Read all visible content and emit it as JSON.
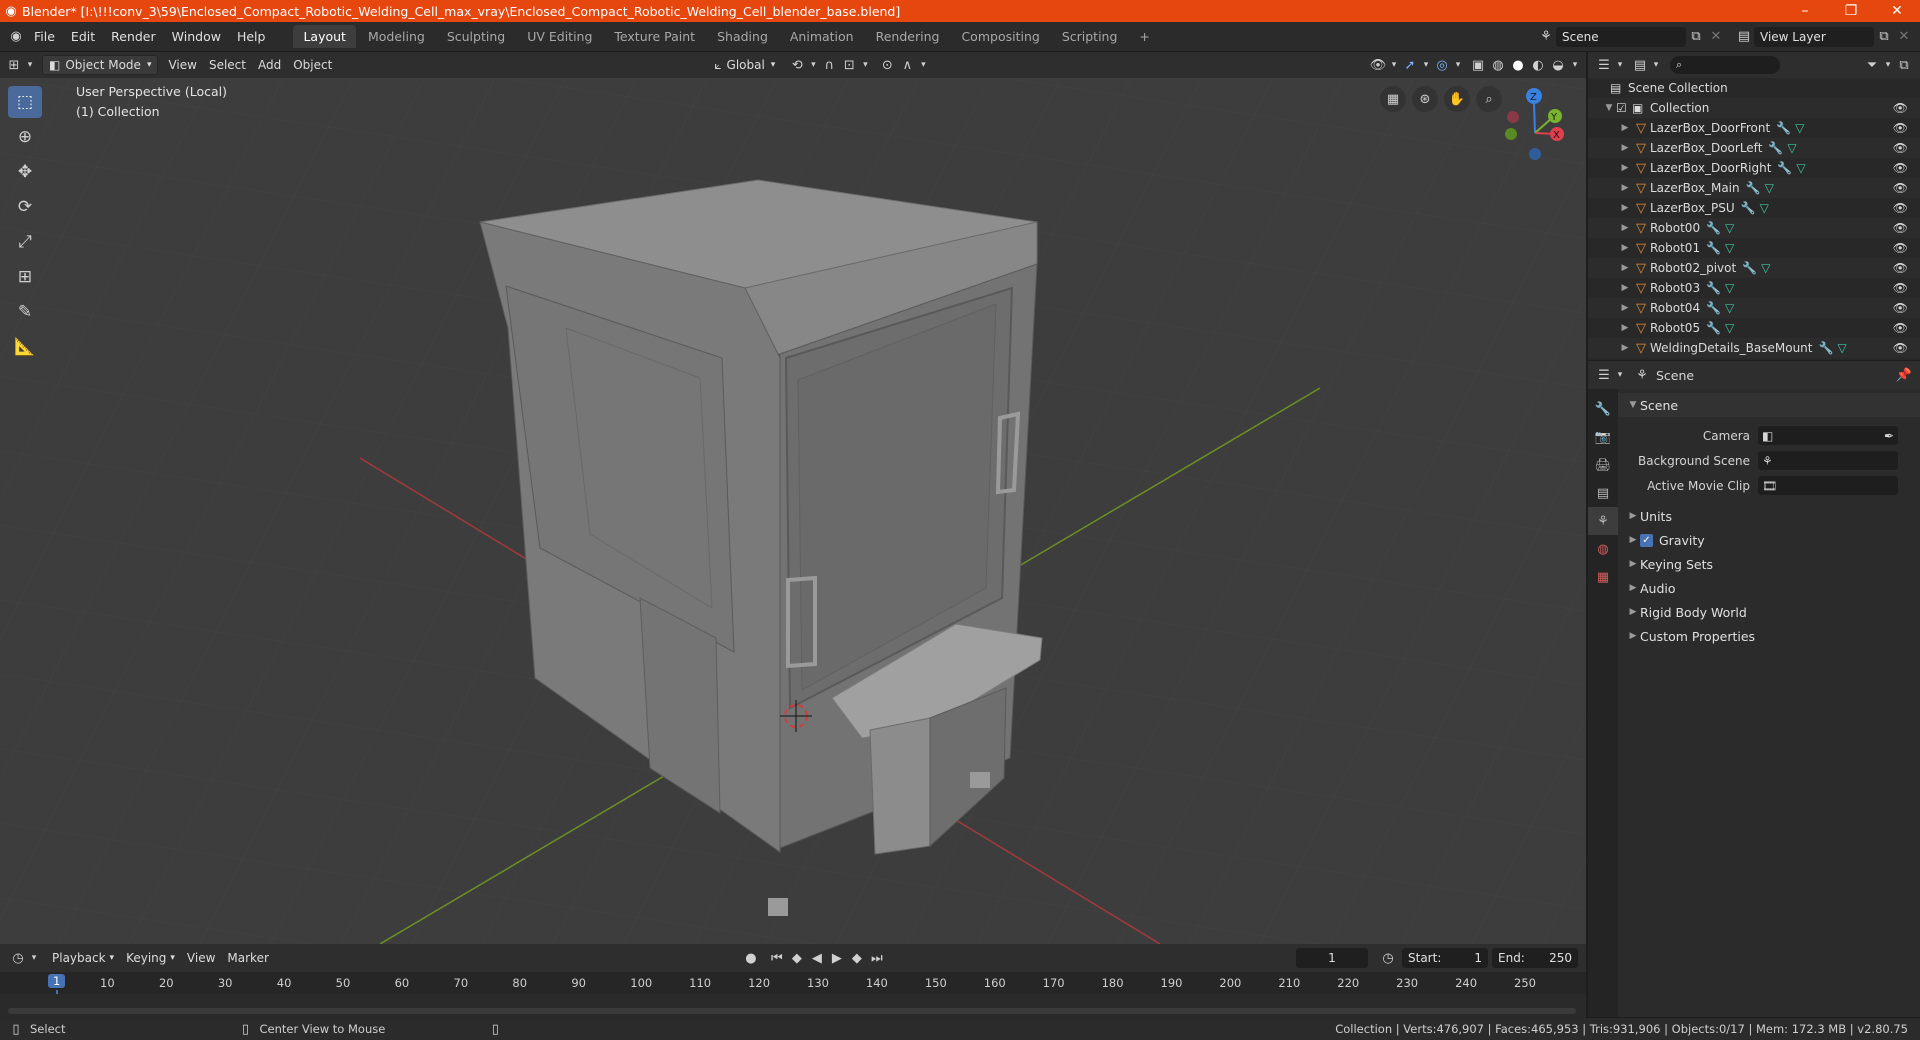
{
  "window": {
    "title": "Blender* [I:\\!!!conv_3\\59\\Enclosed_Compact_Robotic_Welding_Cell_max_vray\\Enclosed_Compact_Robotic_Welding_Cell_blender_base.blend]",
    "minimize": "–",
    "maximize": "❐",
    "close": "✕"
  },
  "menus": [
    "File",
    "Edit",
    "Render",
    "Window",
    "Help"
  ],
  "workspaces": [
    "Layout",
    "Modeling",
    "Sculpting",
    "UV Editing",
    "Texture Paint",
    "Shading",
    "Animation",
    "Rendering",
    "Compositing",
    "Scripting"
  ],
  "workspace_add": "+",
  "scene_name": "Scene",
  "view_layer": "View Layer",
  "viewport_header": {
    "mode": "Object Mode",
    "menus": [
      "View",
      "Select",
      "Add",
      "Object"
    ],
    "orientation": "Global"
  },
  "viewport": {
    "perspective": "User Perspective (Local)",
    "collection": "(1) Collection",
    "gizmo": {
      "x": "X",
      "y": "Y",
      "z": "Z"
    }
  },
  "outliner": {
    "search_placeholder": "",
    "root": "Scene Collection",
    "collection": "Collection",
    "objects": [
      "LazerBox_DoorFront",
      "LazerBox_DoorLeft",
      "LazerBox_DoorRight",
      "LazerBox_Main",
      "LazerBox_PSU",
      "Robot00",
      "Robot01",
      "Robot02_pivot",
      "Robot03",
      "Robot04",
      "Robot05",
      "WeldingDetails_BaseMount"
    ]
  },
  "properties": {
    "context": "Scene",
    "section": "Scene",
    "fields": [
      {
        "label": "Camera",
        "value": ""
      },
      {
        "label": "Background Scene",
        "value": ""
      },
      {
        "label": "Active Movie Clip",
        "value": ""
      }
    ],
    "panels": [
      "Units",
      "Gravity",
      "Keying Sets",
      "Audio",
      "Rigid Body World",
      "Custom Properties"
    ],
    "gravity_checked": true
  },
  "timeline": {
    "menus": [
      "Playback",
      "Keying",
      "View",
      "Marker"
    ],
    "current_frame": "1",
    "start_label": "Start:",
    "start": "1",
    "end_label": "End:",
    "end": "250",
    "ticks": [
      "1",
      "10",
      "20",
      "30",
      "40",
      "50",
      "60",
      "70",
      "80",
      "90",
      "100",
      "110",
      "120",
      "130",
      "140",
      "150",
      "160",
      "170",
      "180",
      "190",
      "200",
      "210",
      "220",
      "230",
      "240",
      "250"
    ]
  },
  "statusbar": {
    "select": "Select",
    "center_view": "Center View to Mouse",
    "stats": "Collection | Verts:476,907 | Faces:465,953 | Tris:931,906 | Objects:0/17 | Mem: 172.3 MB | v2.80.75"
  },
  "colors": {
    "titlebar": "#e6470f",
    "accent": "#4a6a9c",
    "mesh_icon": "#e48b36",
    "axis_x": "#e0404d",
    "axis_y": "#7ab42e",
    "axis_z": "#3a82e0"
  }
}
